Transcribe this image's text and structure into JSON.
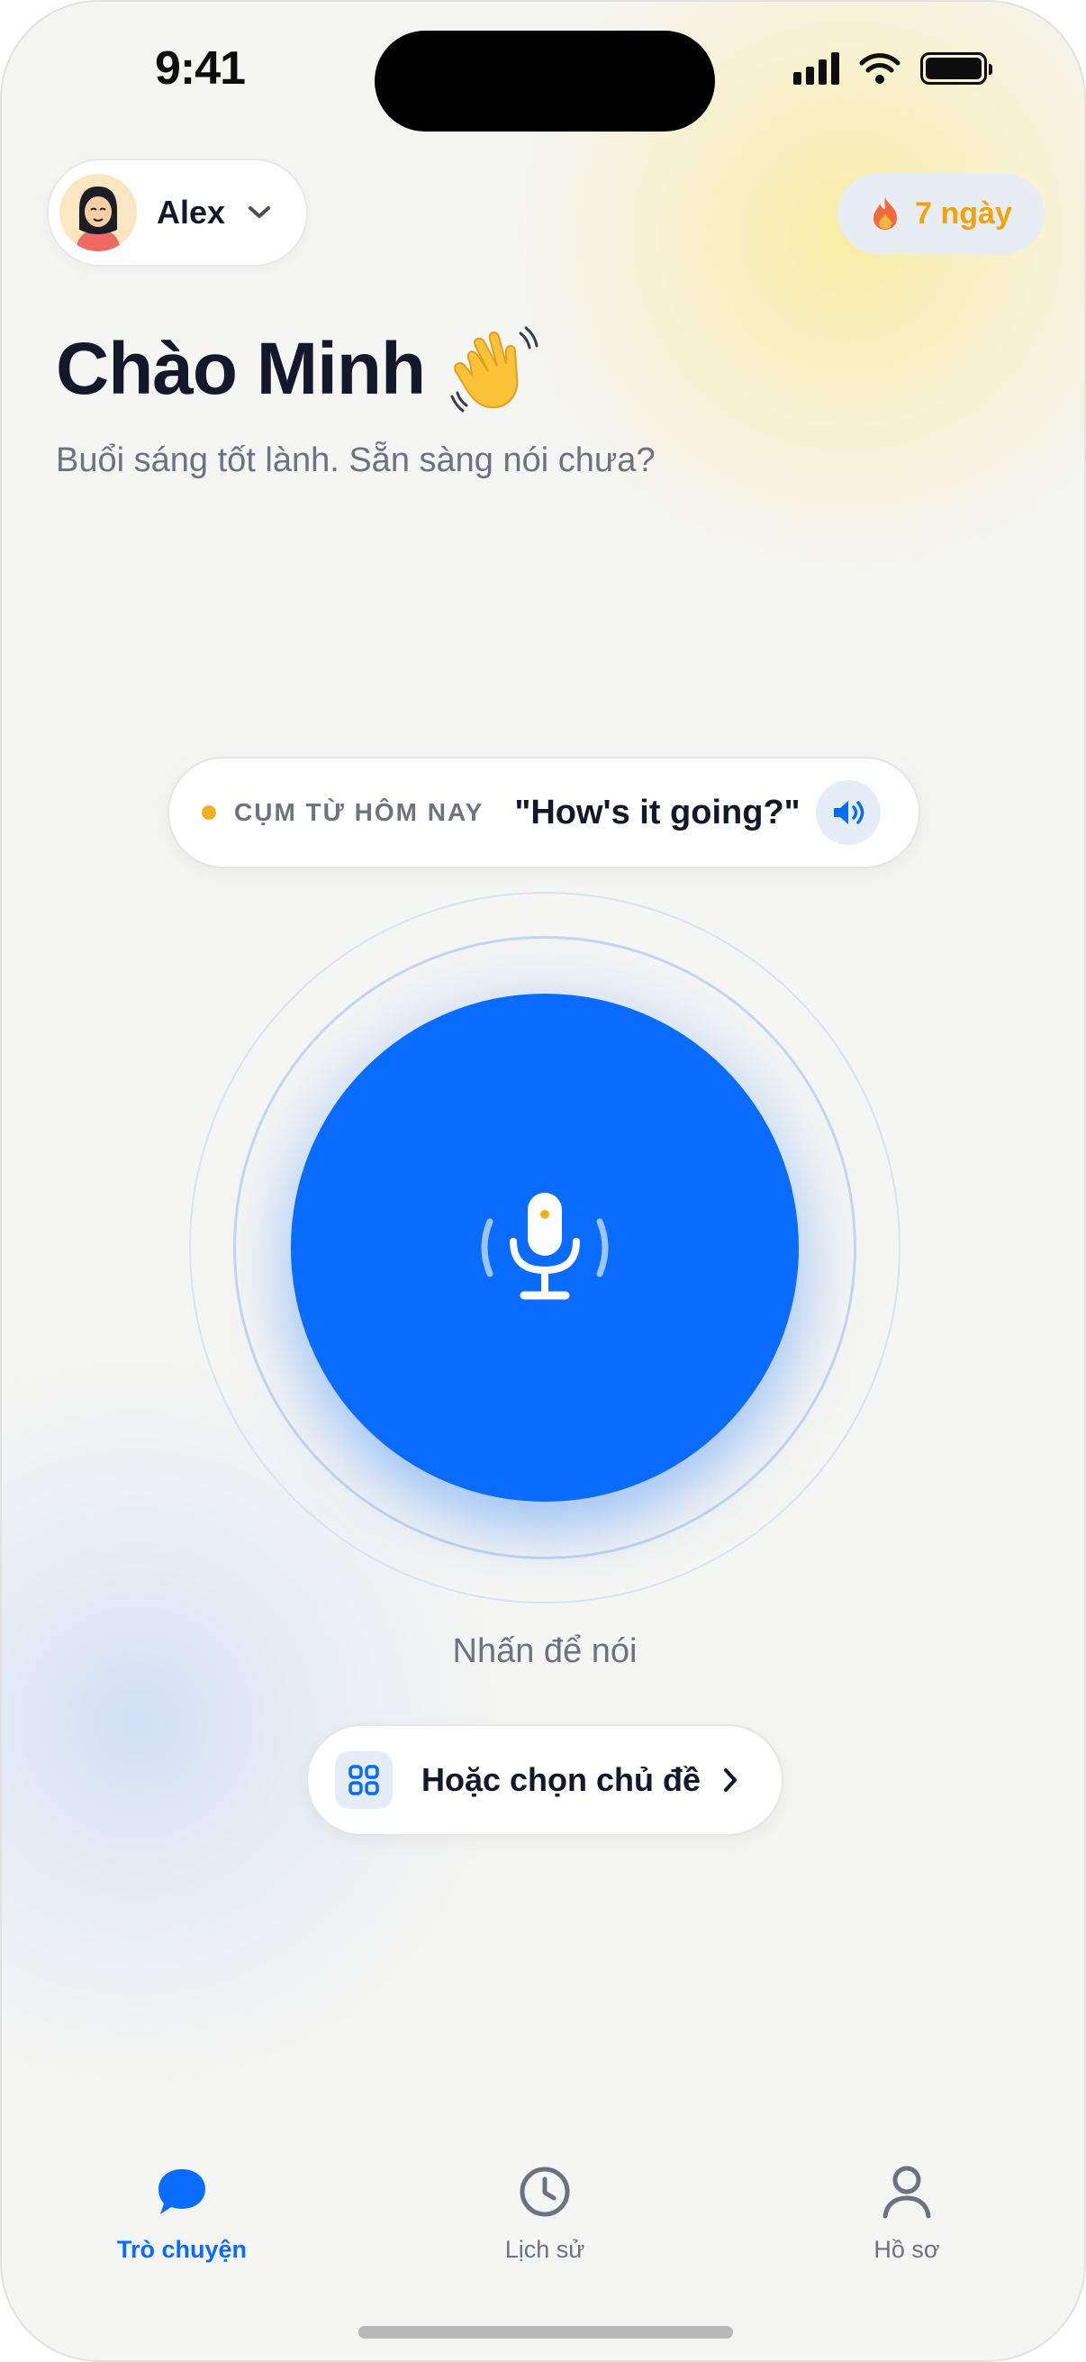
{
  "status_bar": {
    "time": "9:41"
  },
  "profile": {
    "name": "Alex"
  },
  "streak": {
    "label": "7 ngày"
  },
  "greeting": {
    "title": "Chào Minh",
    "emoji": "👋",
    "subtitle": "Buổi sáng tốt lành. Sẵn sàng nói chưa?"
  },
  "phrase": {
    "label": "CỤM TỪ HÔM NAY",
    "text": "\"How's it going?\""
  },
  "mic": {
    "hint": "Nhấn để nói"
  },
  "topic": {
    "label": "Hoặc chọn chủ đề"
  },
  "tabs": [
    {
      "label": "Trò chuyện",
      "icon": "chat-bubble-icon",
      "active": true
    },
    {
      "label": "Lịch sử",
      "icon": "clock-icon",
      "active": false
    },
    {
      "label": "Hồ sơ",
      "icon": "person-icon",
      "active": false
    }
  ],
  "colors": {
    "accent": "#0a6cff",
    "streak": "#f2a20a",
    "text": "#15172b",
    "muted": "#6e7180"
  }
}
